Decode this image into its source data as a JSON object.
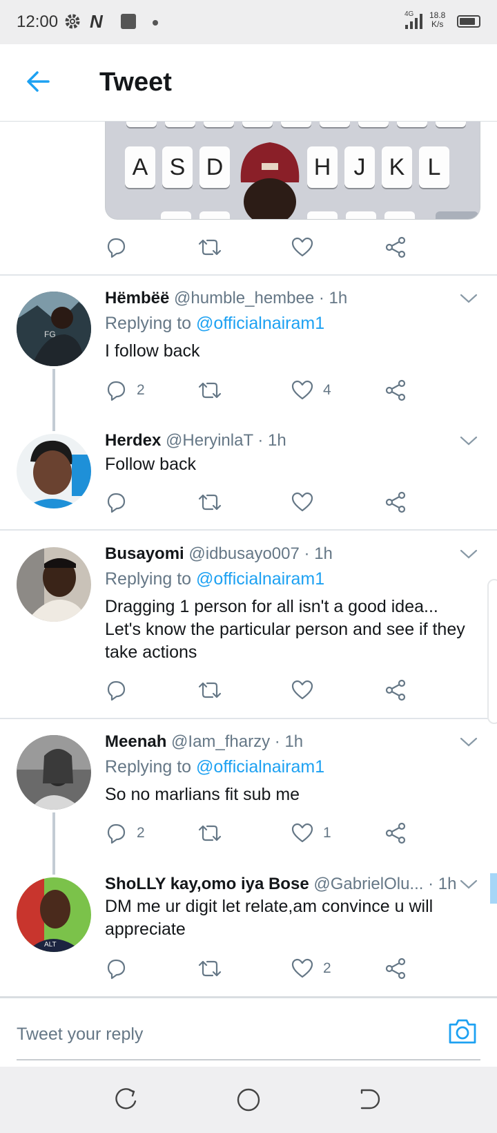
{
  "status_bar": {
    "time": "12:00",
    "network": "4G",
    "speed_value": "18.8",
    "speed_unit": "K/s",
    "icons": [
      "gear-icon",
      "n-app-icon",
      "square-icon",
      "dot-icon",
      "signal-icon",
      "battery-icon"
    ]
  },
  "header": {
    "title": "Tweet",
    "back_icon": "arrow-left-icon"
  },
  "media_keys": [
    "A",
    "S",
    "D",
    "H",
    "J",
    "K",
    "L"
  ],
  "tweets": [
    {
      "name": "Hëmbëë",
      "handle": "@humble_hembee",
      "time": "· 1h",
      "replying_label": "Replying to",
      "mention": "@officialnairam1",
      "text": "I follow back",
      "replies": "2",
      "retweets": "",
      "likes": "4"
    },
    {
      "name": "Herdex",
      "handle": "@HeryinlaT",
      "time": "· 1h",
      "text": "Follow back",
      "replies": "",
      "retweets": "",
      "likes": ""
    },
    {
      "name": "Busayomi",
      "handle": "@idbusayo007",
      "time": "· 1h",
      "replying_label": "Replying to",
      "mention": "@officialnairam1",
      "text": "Dragging 1 person for all isn't a good idea... Let's know the particular person and see if they take actions",
      "replies": "",
      "retweets": "",
      "likes": ""
    },
    {
      "name": "Meenah",
      "handle": "@Iam_fharzy",
      "time": "· 1h",
      "replying_label": "Replying to",
      "mention": "@officialnairam1",
      "text": "So no marlians fit sub me",
      "replies": "2",
      "retweets": "",
      "likes": "1"
    },
    {
      "name": "ShoLLY kay,omo iya Bose",
      "handle": "@GabrielOlu...",
      "time": "· 1h",
      "text": "DM me ur digit let relate,am convince u will appreciate",
      "replies": "",
      "retweets": "",
      "likes": "2"
    }
  ],
  "composer": {
    "placeholder": "Tweet your reply",
    "camera_icon": "camera-icon"
  },
  "nav_bar": {
    "buttons": [
      "recent-apps-icon",
      "home-icon",
      "back-icon"
    ]
  },
  "colors": {
    "accent": "#1da1f2",
    "secondary_text": "#657786",
    "primary_text": "#14171a",
    "divider": "#e1e5e9"
  }
}
